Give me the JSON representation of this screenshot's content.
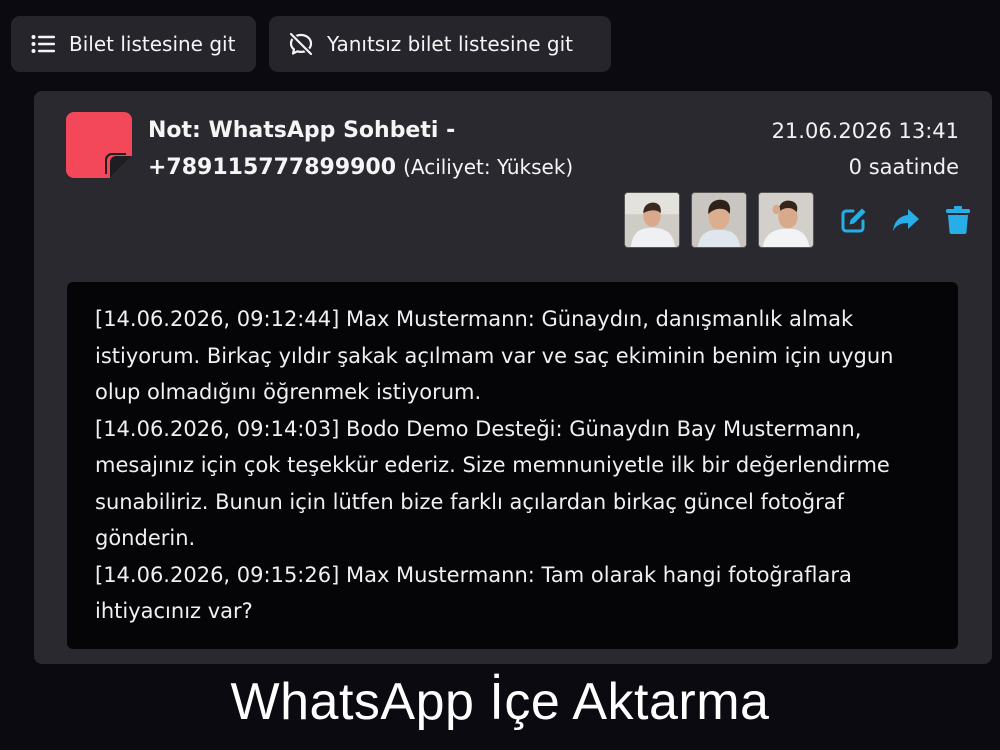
{
  "toolbar": {
    "ticket_list_label": "Bilet listesine git",
    "unanswered_list_label": "Yanıtsız bilet listesine git"
  },
  "ticket": {
    "title_bold": "Not: WhatsApp Sohbeti - +789115777899900",
    "urgency": "(Aciliyet: Yüksek)",
    "datetime": "21.06.2026 13:41",
    "age": "0 saatinde",
    "accent_color": "#f2485a",
    "action_color": "#27aee8",
    "icons": [
      "list-icon",
      "no-comment-icon",
      "note-icon",
      "edit-icon",
      "forward-icon",
      "trash-icon"
    ],
    "attachments": [
      "photo-1",
      "photo-2",
      "photo-3"
    ]
  },
  "chat": {
    "messages": [
      "[14.06.2026, 09:12:44] Max Mustermann: Günaydın, danışmanlık almak istiyorum. Birkaç yıldır şakak açılmam var ve saç ekiminin benim için uygun olup olmadığını öğrenmek istiyorum.",
      "[14.06.2026, 09:14:03] Bodo Demo Desteği: Günaydın Bay Mustermann, mesajınız için çok teşekkür ederiz. Size memnuniyetle ilk bir değerlendirme sunabiliriz. Bunun için lütfen bize farklı açılardan birkaç güncel fotoğraf gönderin.",
      "[14.06.2026, 09:15:26] Max Mustermann: Tam olarak hangi fotoğraflara ihtiyacınız var?"
    ]
  },
  "caption": "WhatsApp İçe Aktarma"
}
